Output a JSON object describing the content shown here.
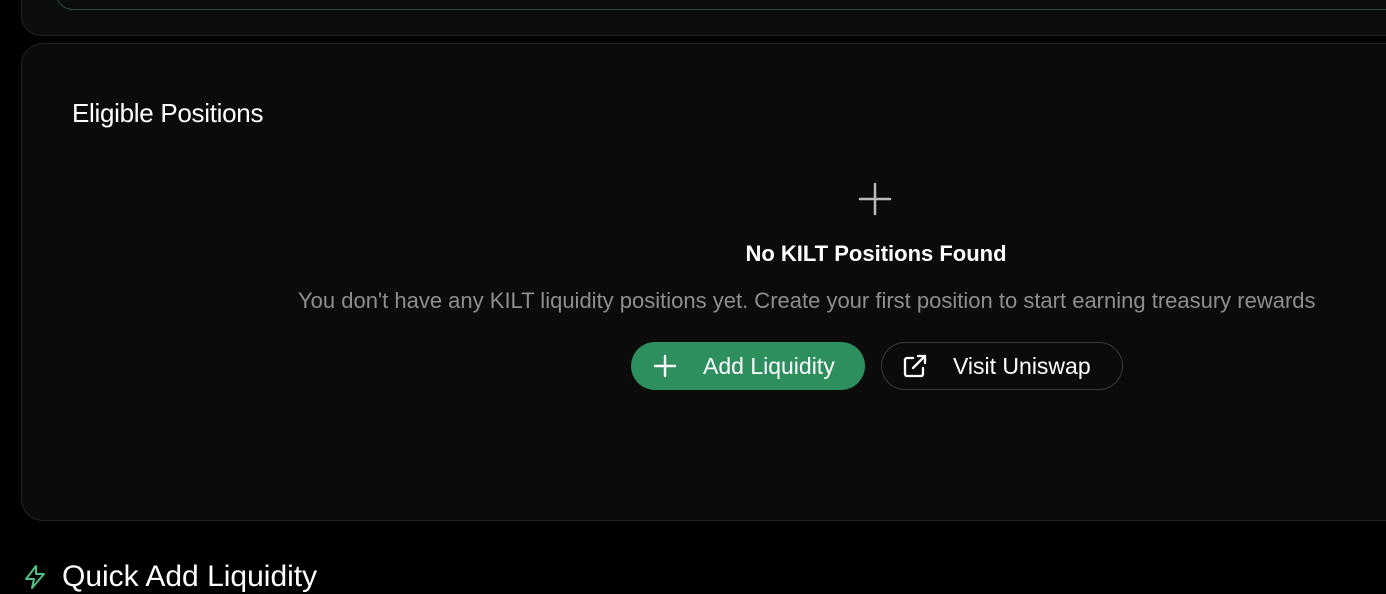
{
  "eligible_positions": {
    "title": "Eligible Positions",
    "empty_state": {
      "icon": "plus-icon",
      "title": "No KILT Positions Found",
      "message": "You don't have any KILT liquidity positions yet. Create your first position to start earning treasury rewards"
    },
    "actions": {
      "add_liquidity": {
        "label": "Add Liquidity",
        "icon": "plus-icon"
      },
      "visit_uniswap": {
        "label": "Visit Uniswap",
        "icon": "external-link-icon"
      }
    }
  },
  "quick_add": {
    "title": "Quick Add Liquidity",
    "icon": "lightning-icon"
  },
  "colors": {
    "background": "#000000",
    "card": "#0b0b0b",
    "accent": "#2e8f5e",
    "muted_text": "#8e8e8e"
  }
}
